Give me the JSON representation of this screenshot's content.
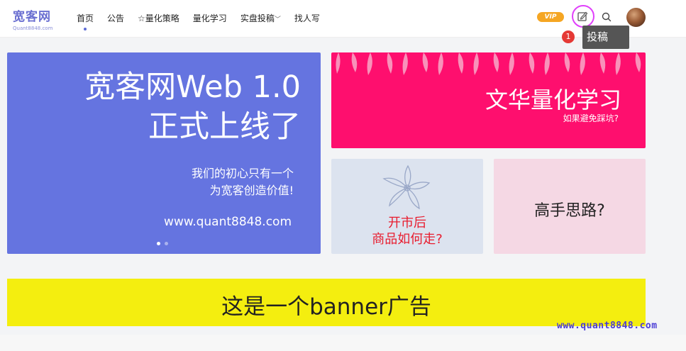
{
  "site": {
    "logo": "宽客网",
    "logo_sub": "Quant8848.com"
  },
  "nav": {
    "items": [
      "首页",
      "公告",
      "☆量化策略",
      "量化学习",
      "实盘投稿",
      "找人写"
    ],
    "active_index": 0
  },
  "header": {
    "vip_label": "VIP",
    "post_tooltip": "投稿",
    "post_badge": "1"
  },
  "main_banner": {
    "title_line1": "宽客网Web 1.0",
    "title_line2": "正式上线了",
    "sub_line1": "我们的初心只有一个",
    "sub_line2": "为宽客创造价值!",
    "url": "www.quant8848.com",
    "bg": "#6574e0",
    "slide_count": 2,
    "active_slide": 1
  },
  "pink_card": {
    "title": "文华量化学习",
    "subtitle": "如果避免踩坑?",
    "bg": "#fe0f6e"
  },
  "grey_card": {
    "line1": "开市后",
    "line2": "商品如何走?",
    "bg": "#dce3ef",
    "text_color": "#e81c2e"
  },
  "lightpink_card": {
    "title": "高手思路?",
    "bg": "#f5d8e4"
  },
  "ad_banner": {
    "text": "这是一个banner广告",
    "bg": "#f4ee0f"
  },
  "watermark": "www.quant8848.com",
  "icons": {
    "post": "edit-icon",
    "search": "search-icon",
    "avatar": "avatar"
  }
}
